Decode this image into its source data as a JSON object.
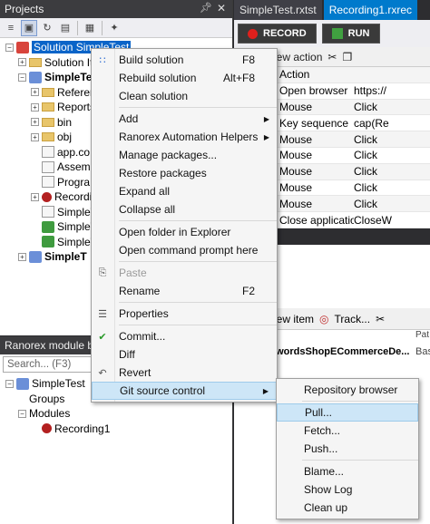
{
  "projects_panel": {
    "title": "Projects",
    "pin_icon": "pin-icon",
    "close_icon": "close-icon",
    "tree": [
      {
        "label": "Solution SimpleTest",
        "indent": 0,
        "exp": "-",
        "icon": "solution",
        "selected": true
      },
      {
        "label": "Solution It",
        "indent": 1,
        "exp": "+",
        "icon": "folder"
      },
      {
        "label": "SimpleTes",
        "indent": 1,
        "exp": "-",
        "icon": "project",
        "bold": true
      },
      {
        "label": "Referer",
        "indent": 2,
        "exp": "+",
        "icon": "folder"
      },
      {
        "label": "Reports",
        "indent": 2,
        "exp": "+",
        "icon": "folder"
      },
      {
        "label": "bin",
        "indent": 2,
        "exp": "+",
        "icon": "folder"
      },
      {
        "label": "obj",
        "indent": 2,
        "exp": "+",
        "icon": "folder"
      },
      {
        "label": "app.co",
        "indent": 2,
        "exp": "",
        "icon": "file"
      },
      {
        "label": "Assemb",
        "indent": 2,
        "exp": "",
        "icon": "file"
      },
      {
        "label": "Progra",
        "indent": 2,
        "exp": "",
        "icon": "file"
      },
      {
        "label": "Recordi",
        "indent": 2,
        "exp": "+",
        "icon": "rec"
      },
      {
        "label": "SimpleT",
        "indent": 2,
        "exp": "",
        "icon": "file"
      },
      {
        "label": "SimpleT",
        "indent": 2,
        "exp": "",
        "icon": "repo"
      },
      {
        "label": "SimpleT",
        "indent": 2,
        "exp": "",
        "icon": "repo"
      },
      {
        "label": "SimpleT",
        "indent": 1,
        "exp": "+",
        "icon": "project",
        "bold": true
      }
    ]
  },
  "module_browser": {
    "title": "Ranorex module br",
    "search_placeholder": "Search... (F3)",
    "tree": [
      {
        "label": "SimpleTest",
        "indent": 0,
        "exp": "-",
        "icon": "project"
      },
      {
        "label": "Groups",
        "indent": 1,
        "exp": "",
        "icon": "none"
      },
      {
        "label": "Modules",
        "indent": 1,
        "exp": "-",
        "icon": "none"
      },
      {
        "label": "Recording1",
        "indent": 2,
        "exp": "",
        "icon": "rec"
      }
    ]
  },
  "tabs": [
    {
      "label": "SimpleTest.rxtst",
      "active": false
    },
    {
      "label": "Recording1.rxrec",
      "active": true
    }
  ],
  "recorder": {
    "record_label": "RECORD",
    "run_label": "RUN",
    "new_action_label": "new action",
    "rows": [
      {
        "c1": "Action",
        "c2": ""
      },
      {
        "c1": "Open browser",
        "c2": "https://"
      },
      {
        "c1": "Mouse",
        "c2": "Click"
      },
      {
        "c1": "Key sequence",
        "c2": "cap(Re"
      },
      {
        "c1": "Mouse",
        "c2": "Click"
      },
      {
        "c1": "Mouse",
        "c2": "Click"
      },
      {
        "c1": "Mouse",
        "c2": "Click"
      },
      {
        "c1": "Mouse",
        "c2": "Click"
      },
      {
        "c1": "Mouse",
        "c2": "Click"
      },
      {
        "c1": "Close application",
        "c2": "CloseW"
      }
    ]
  },
  "repository": {
    "new_item_label": "new item",
    "track_label": "Track...",
    "header_right": "Pat",
    "item_label": "ewordsShopECommerceDe...",
    "item_base": "Bas"
  },
  "context_menu": {
    "items": [
      {
        "type": "item",
        "label": "Build solution",
        "key": "F8",
        "icon": "build-icon"
      },
      {
        "type": "item",
        "label": "Rebuild solution",
        "key": "Alt+F8",
        "icon": ""
      },
      {
        "type": "item",
        "label": "Clean solution",
        "key": "",
        "icon": ""
      },
      {
        "type": "sep"
      },
      {
        "type": "item",
        "label": "Add",
        "key": "",
        "icon": "",
        "submenu": true
      },
      {
        "type": "item",
        "label": "Ranorex Automation Helpers",
        "key": "",
        "icon": "",
        "submenu": true
      },
      {
        "type": "item",
        "label": "Manage packages...",
        "key": "",
        "icon": ""
      },
      {
        "type": "item",
        "label": "Restore packages",
        "key": "",
        "icon": ""
      },
      {
        "type": "item",
        "label": "Expand all",
        "key": "",
        "icon": ""
      },
      {
        "type": "item",
        "label": "Collapse all",
        "key": "",
        "icon": ""
      },
      {
        "type": "sep"
      },
      {
        "type": "item",
        "label": "Open folder in Explorer",
        "key": "",
        "icon": ""
      },
      {
        "type": "item",
        "label": "Open command prompt here",
        "key": "",
        "icon": ""
      },
      {
        "type": "sep"
      },
      {
        "type": "item",
        "label": "Paste",
        "key": "",
        "icon": "paste-icon",
        "disabled": true
      },
      {
        "type": "item",
        "label": "Rename",
        "key": "F2",
        "icon": ""
      },
      {
        "type": "sep"
      },
      {
        "type": "item",
        "label": "Properties",
        "key": "",
        "icon": "properties-icon"
      },
      {
        "type": "sep"
      },
      {
        "type": "item",
        "label": "Commit...",
        "key": "",
        "icon": "commit-icon"
      },
      {
        "type": "item",
        "label": "Diff",
        "key": "",
        "icon": ""
      },
      {
        "type": "item",
        "label": "Revert",
        "key": "",
        "icon": "revert-icon"
      },
      {
        "type": "item",
        "label": "Git source control",
        "key": "",
        "icon": "",
        "submenu": true,
        "highlight": true
      }
    ]
  },
  "git_submenu": {
    "items": [
      {
        "type": "item",
        "label": "Repository browser"
      },
      {
        "type": "sep"
      },
      {
        "type": "item",
        "label": "Pull...",
        "highlight": true
      },
      {
        "type": "item",
        "label": "Fetch..."
      },
      {
        "type": "item",
        "label": "Push..."
      },
      {
        "type": "sep"
      },
      {
        "type": "item",
        "label": "Blame..."
      },
      {
        "type": "item",
        "label": "Show Log"
      },
      {
        "type": "item",
        "label": "Clean up"
      }
    ]
  }
}
